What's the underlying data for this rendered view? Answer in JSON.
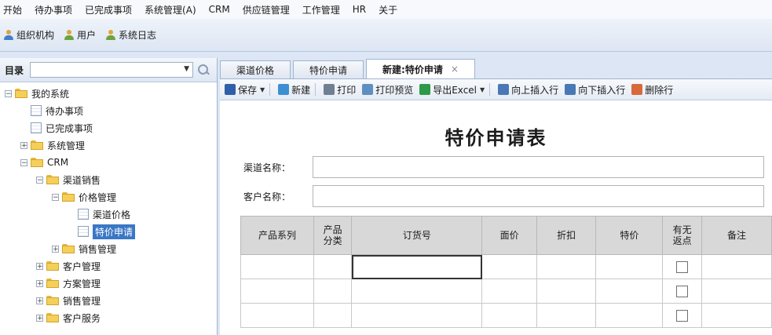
{
  "menu": [
    "开始",
    "待办事项",
    "已完成事项",
    "系统管理(A)",
    "CRM",
    "供应链管理",
    "工作管理",
    "HR",
    "关于"
  ],
  "quick": [
    "组织机构",
    "用户",
    "系统日志"
  ],
  "sidebar": {
    "title": "目录",
    "combo_value": "",
    "tree": [
      {
        "label": "我的系统",
        "type": "folder",
        "toggle": "−",
        "level": 0
      },
      {
        "label": "待办事项",
        "type": "page",
        "level": 1
      },
      {
        "label": "已完成事项",
        "type": "page",
        "level": 1
      },
      {
        "label": "系统管理",
        "type": "folder",
        "toggle": "+",
        "level": 1
      },
      {
        "label": "CRM",
        "type": "folder",
        "toggle": "−",
        "level": 1
      },
      {
        "label": "渠道销售",
        "type": "folder",
        "toggle": "−",
        "level": 2
      },
      {
        "label": "价格管理",
        "type": "folder",
        "toggle": "−",
        "level": 3
      },
      {
        "label": "渠道价格",
        "type": "page",
        "level": 4
      },
      {
        "label": "特价申请",
        "type": "page",
        "level": 4,
        "selected": true
      },
      {
        "label": "销售管理",
        "type": "folder",
        "toggle": "+",
        "level": 3
      },
      {
        "label": "客户管理",
        "type": "folder",
        "toggle": "+",
        "level": 2
      },
      {
        "label": "方案管理",
        "type": "folder",
        "toggle": "+",
        "level": 2
      },
      {
        "label": "销售管理",
        "type": "folder",
        "toggle": "+",
        "level": 2
      },
      {
        "label": "客户服务",
        "type": "folder",
        "toggle": "+",
        "level": 2
      }
    ]
  },
  "tabs": [
    {
      "label": "渠道价格",
      "active": false
    },
    {
      "label": "特价申请",
      "active": false
    },
    {
      "label": "新建:特价申请",
      "active": true,
      "close": "×"
    }
  ],
  "toolbar": [
    {
      "label": "保存",
      "dropdown": true,
      "color": "#2f5fa8"
    },
    {
      "label": "新建",
      "color": "#3d8fd1"
    },
    {
      "label": "打印",
      "color": "#6f7f94"
    },
    {
      "label": "打印预览",
      "color": "#5f8fc0"
    },
    {
      "label": "导出Excel",
      "dropdown": true,
      "color": "#2e9a48"
    },
    {
      "label": "向上插入行",
      "color": "#4a78b5"
    },
    {
      "label": "向下插入行",
      "color": "#4a78b5"
    },
    {
      "label": "删除行",
      "color": "#d66a3a"
    }
  ],
  "form": {
    "title": "特价申请表",
    "channel_label": "渠道名称：",
    "channel_value": "",
    "customer_label": "客户名称：",
    "customer_value": ""
  },
  "grid": {
    "columns": [
      "产品系列",
      "产品分类",
      "订货号",
      "面价",
      "折扣",
      "特价",
      "有无返点",
      "备注"
    ],
    "rows": [
      [
        "",
        "",
        "",
        "",
        "",
        "",
        false,
        ""
      ],
      [
        "",
        "",
        "",
        "",
        "",
        "",
        false,
        ""
      ],
      [
        "",
        "",
        "",
        "",
        "",
        "",
        false,
        ""
      ]
    ]
  }
}
